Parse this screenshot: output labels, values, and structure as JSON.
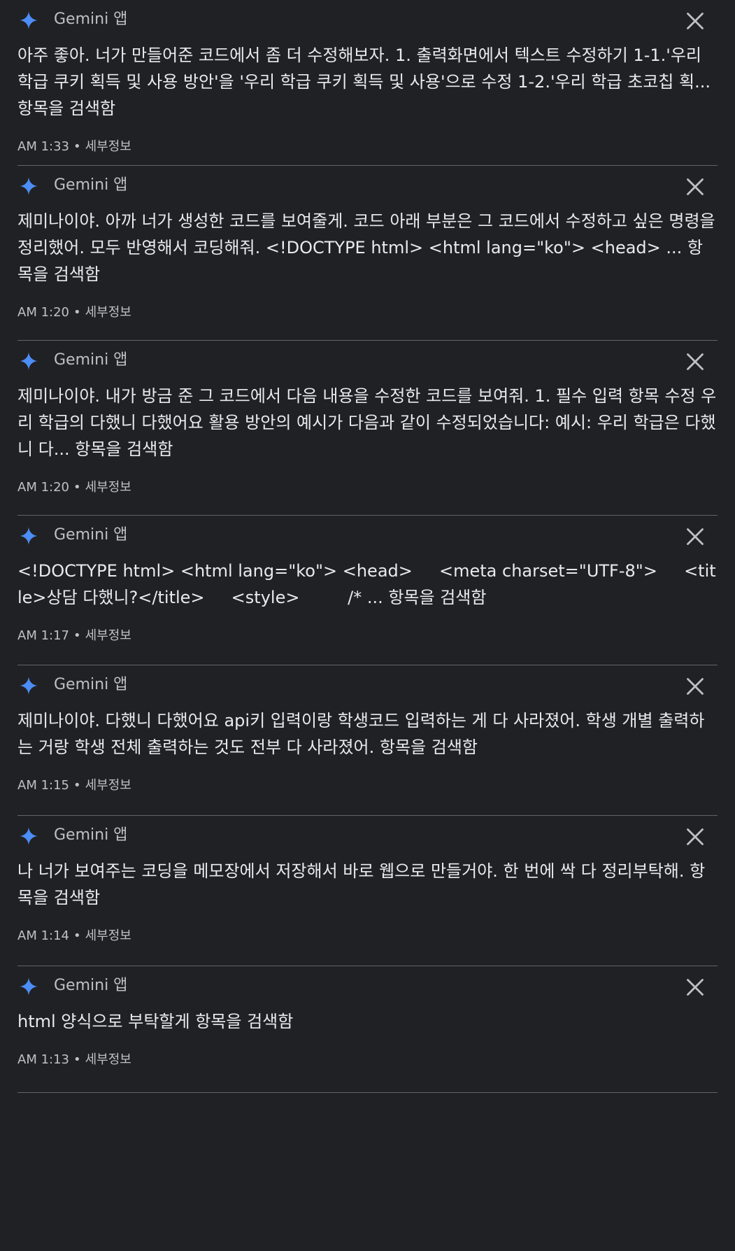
{
  "colors": {
    "background": "#202124",
    "text_primary": "#e8eaed",
    "text_secondary": "#bdc1c6",
    "divider": "#5f6368",
    "spark_blue": "#4c8df6"
  },
  "entries": [
    {
      "app": "Gemini 앱",
      "icon": "gemini-spark-icon",
      "text": "아주 좋아. 너가 만들어준 코드에서 좀 더 수정해보자. 1. 출력화면에서 텍스트 수정하기 1-1.'우리 학급 쿠키 획득 및 사용 방안'을 '우리 학급 쿠키 획득 및 사용'으로 수정 1-2.'우리 학급 초코칩 획... 항목을 검색함",
      "time": "AM 1:33",
      "details": "세부정보"
    },
    {
      "app": "Gemini 앱",
      "icon": "gemini-spark-icon",
      "text": "제미나이야. 아까 너가 생성한 코드를 보여줄게. 코드 아래 부분은 그 코드에서 수정하고 싶은 명령을 정리했어. 모두 반영해서 코딩해줘. <!DOCTYPE html> <html lang=\"ko\"> <head> ... 항목을 검색함",
      "time": "AM 1:20",
      "details": "세부정보"
    },
    {
      "app": "Gemini 앱",
      "icon": "gemini-spark-icon",
      "text": "제미나이야. 내가 방금 준 그 코드에서 다음 내용을 수정한 코드를 보여줘. 1. 필수 입력 항목 수정 우리 학급의 다했니 다했어요 활용 방안의 예시가 다음과 같이 수정되었습니다: 예시: 우리 학급은 다했니 다... 항목을 검색함",
      "time": "AM 1:20",
      "details": "세부정보"
    },
    {
      "app": "Gemini 앱",
      "icon": "gemini-spark-icon",
      "text": "<!DOCTYPE html> <html lang=\"ko\"> <head>     <meta charset=\"UTF-8\">     <title>상담 다했니?</title>     <style>         /* ... 항목을 검색함",
      "time": "AM 1:17",
      "details": "세부정보"
    },
    {
      "app": "Gemini 앱",
      "icon": "gemini-spark-icon",
      "text": "제미나이야. 다했니 다했어요 api키 입력이랑 학생코드 입력하는 게 다 사라졌어. 학생 개별 출력하는 거랑 학생 전체 출력하는 것도 전부 다 사라졌어. 항목을 검색함",
      "time": "AM 1:15",
      "details": "세부정보"
    },
    {
      "app": "Gemini 앱",
      "icon": "gemini-spark-icon",
      "text": "나 너가 보여주는 코딩을 메모장에서 저장해서 바로 웹으로 만들거야. 한 번에 싹 다 정리부탁해. 항목을 검색함",
      "time": "AM 1:14",
      "details": "세부정보"
    },
    {
      "app": "Gemini 앱",
      "icon": "gemini-spark-icon",
      "text": "html 양식으로 부탁할게 항목을 검색함",
      "time": "AM 1:13",
      "details": "세부정보"
    }
  ]
}
